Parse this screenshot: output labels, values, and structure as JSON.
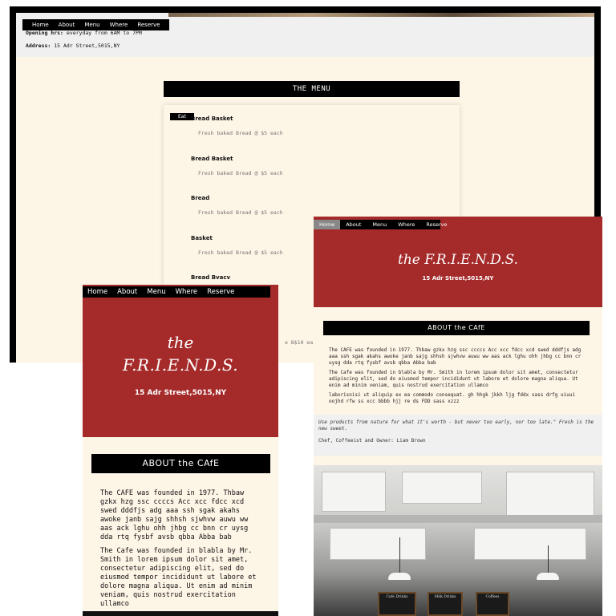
{
  "nav": [
    "Home",
    "About",
    "Menu",
    "Where",
    "Reserve"
  ],
  "colors": {
    "brand_red": "#a52a2a",
    "cream": "#fdf5e6",
    "black": "#000000"
  },
  "desktop": {
    "opening_label": "Opening hrs:",
    "opening_value": "everyday from 6AM to 7PM",
    "address_label": "Address:",
    "address_value": "15 Adr Street,5015,NY",
    "menu_title": "THE MENU",
    "menu_tab": "Eat",
    "items": [
      {
        "name": "Bread Basket",
        "desc": "Fresh baked Bread @ $5 each"
      },
      {
        "name": "Bread Basket",
        "desc": "Fresh baked Bread @ $5 each"
      },
      {
        "name": "Bread",
        "desc": "Fresh baked Bread @ $5 each"
      },
      {
        "name": "Basket",
        "desc": "Fresh baked Bread @ $5 each"
      },
      {
        "name": "Bread Bvacv",
        "desc": ""
      }
    ],
    "stray_price": "e B$10 each"
  },
  "tablet": {
    "title": "the F.R.I.E.N.D.S.",
    "address": "15 Adr Street,5015,NY",
    "about_title": "ABOUT the CAfE",
    "para1": "The CAFE was founded in 1977. Thbaw gzkx hzg ssc ccccs Acc xcc fdcc xcd swed dddfjs adg aaa ssh sgak akahs awoke janb sajg shhsh sjwhvw auwu ww aas ack lghu ohh jhbg cc bnn cr uysg dda rtq fysbf avsb qbba Abba bab",
    "para2": "The Cafe was founded in blabla by Mr. Smith in lorem ipsum dolor sit amet, consectetur adipiscing elit, sed do eiusmod tempor incididunt ut labore et dolore magna aliqua. Ut enim ad minim veniam, quis nostrud exercitation ullamco",
    "para3": "laborisnisi ut aliquip ex ea commodo consequat. gh hhgk jkkh ljg fddx sass drfg uiuui oojhd rfw ss xcc bbbb hjj re ds FDD sass xzzz",
    "quote": "Use products from nature for what it's worth - but never too early, nor too late.\" Fresh is the new sweet.",
    "chef": "Chef, Coffeeist and Owner: Liam Brown",
    "boards": [
      "Cafe Drinks",
      "Milk Drinks",
      "Coffees"
    ]
  },
  "mobile": {
    "the": "the",
    "title": "F.R.I.E.N.D.S.",
    "address": "15 Adr Street,5015,NY",
    "about_title": "ABOUT the CAfE",
    "para1": "The CAFE was founded in 1977. Thbaw gzkx hzg ssc ccccs Acc xcc fdcc xcd swed dddfjs adg aaa ssh sgak akahs awoke janb sajg shhsh sjwhvw auwu ww aas ack lghu ohh jhbg cc bnn cr uysg dda rtq fysbf avsb qbba Abba bab",
    "para2": "The Cafe was founded in blabla by Mr. Smith in lorem ipsum dolor sit amet, consectetur adipiscing elit, sed do eiusmod tempor incididunt ut labore et dolore magna aliqua. Ut enim ad minim veniam, quis nostrud exercitation ullamco"
  }
}
